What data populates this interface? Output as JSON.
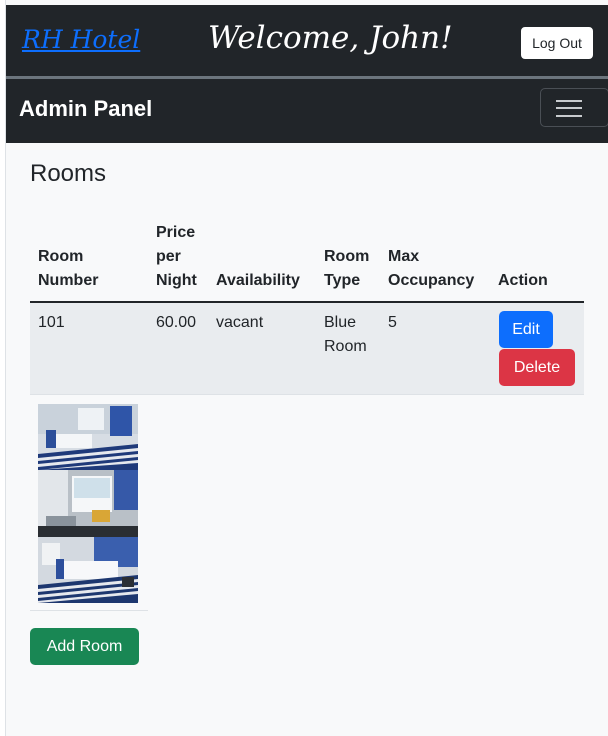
{
  "header": {
    "brand": "RH Hotel",
    "welcome": "Welcome, John!",
    "logout_label": "Log Out"
  },
  "navbar": {
    "title": "Admin Panel",
    "menu_icon": "hamburger-menu-icon"
  },
  "page": {
    "title": "Rooms"
  },
  "table": {
    "columns": {
      "room_number": [
        "Room",
        "Number"
      ],
      "price": [
        "Price",
        "per",
        "Night"
      ],
      "availability": "Availability",
      "room_type": [
        "Room",
        "Type"
      ],
      "max_occupancy": [
        "Max",
        "Occupancy"
      ],
      "action": "Action"
    },
    "rows": [
      {
        "room_number": "101",
        "price": "60.00",
        "availability": "vacant",
        "room_type": [
          "Blue",
          "Room"
        ],
        "max_occupancy": "5",
        "edit_label": "Edit",
        "delete_label": "Delete"
      }
    ]
  },
  "images": [
    "room-photo-1",
    "room-photo-2",
    "room-photo-3"
  ],
  "add_room_label": "Add Room",
  "colors": {
    "navbar_bg": "#212529",
    "brand_link": "#0d6efd",
    "edit": "#0d6efd",
    "delete": "#dc3545",
    "add": "#198754",
    "row_bg": "#e9ecef",
    "page_bg": "#f8f9fa"
  }
}
